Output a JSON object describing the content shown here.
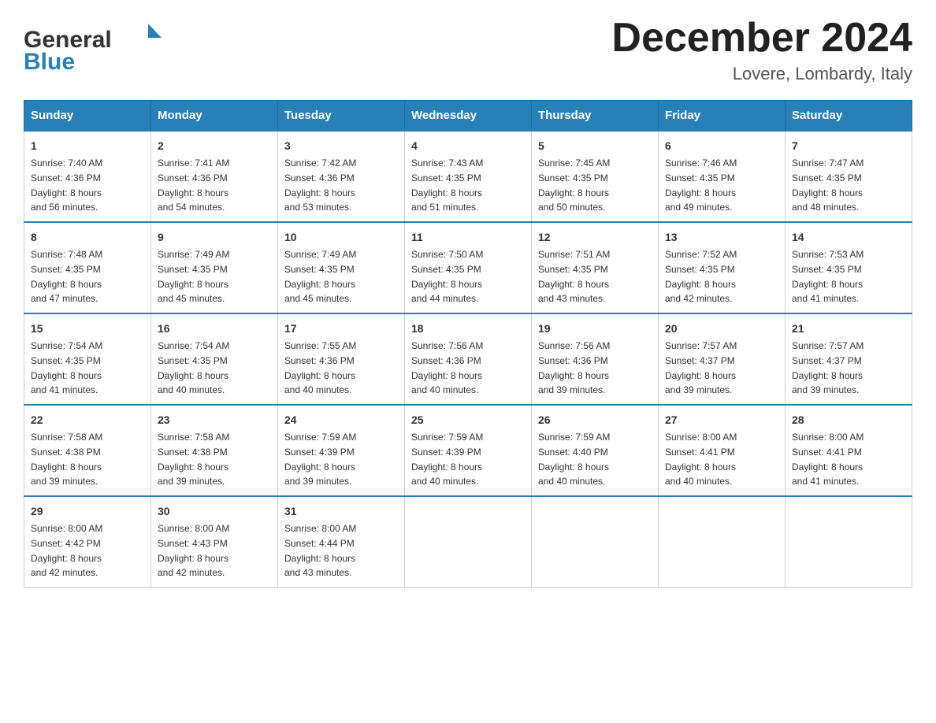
{
  "header": {
    "logo": {
      "general": "General",
      "blue": "Blue"
    },
    "title": "December 2024",
    "location": "Lovere, Lombardy, Italy"
  },
  "weekdays": [
    "Sunday",
    "Monday",
    "Tuesday",
    "Wednesday",
    "Thursday",
    "Friday",
    "Saturday"
  ],
  "weeks": [
    [
      {
        "day": "1",
        "sunrise": "7:40 AM",
        "sunset": "4:36 PM",
        "daylight": "8 hours and 56 minutes."
      },
      {
        "day": "2",
        "sunrise": "7:41 AM",
        "sunset": "4:36 PM",
        "daylight": "8 hours and 54 minutes."
      },
      {
        "day": "3",
        "sunrise": "7:42 AM",
        "sunset": "4:36 PM",
        "daylight": "8 hours and 53 minutes."
      },
      {
        "day": "4",
        "sunrise": "7:43 AM",
        "sunset": "4:35 PM",
        "daylight": "8 hours and 51 minutes."
      },
      {
        "day": "5",
        "sunrise": "7:45 AM",
        "sunset": "4:35 PM",
        "daylight": "8 hours and 50 minutes."
      },
      {
        "day": "6",
        "sunrise": "7:46 AM",
        "sunset": "4:35 PM",
        "daylight": "8 hours and 49 minutes."
      },
      {
        "day": "7",
        "sunrise": "7:47 AM",
        "sunset": "4:35 PM",
        "daylight": "8 hours and 48 minutes."
      }
    ],
    [
      {
        "day": "8",
        "sunrise": "7:48 AM",
        "sunset": "4:35 PM",
        "daylight": "8 hours and 47 minutes."
      },
      {
        "day": "9",
        "sunrise": "7:49 AM",
        "sunset": "4:35 PM",
        "daylight": "8 hours and 45 minutes."
      },
      {
        "day": "10",
        "sunrise": "7:49 AM",
        "sunset": "4:35 PM",
        "daylight": "8 hours and 45 minutes."
      },
      {
        "day": "11",
        "sunrise": "7:50 AM",
        "sunset": "4:35 PM",
        "daylight": "8 hours and 44 minutes."
      },
      {
        "day": "12",
        "sunrise": "7:51 AM",
        "sunset": "4:35 PM",
        "daylight": "8 hours and 43 minutes."
      },
      {
        "day": "13",
        "sunrise": "7:52 AM",
        "sunset": "4:35 PM",
        "daylight": "8 hours and 42 minutes."
      },
      {
        "day": "14",
        "sunrise": "7:53 AM",
        "sunset": "4:35 PM",
        "daylight": "8 hours and 41 minutes."
      }
    ],
    [
      {
        "day": "15",
        "sunrise": "7:54 AM",
        "sunset": "4:35 PM",
        "daylight": "8 hours and 41 minutes."
      },
      {
        "day": "16",
        "sunrise": "7:54 AM",
        "sunset": "4:35 PM",
        "daylight": "8 hours and 40 minutes."
      },
      {
        "day": "17",
        "sunrise": "7:55 AM",
        "sunset": "4:36 PM",
        "daylight": "8 hours and 40 minutes."
      },
      {
        "day": "18",
        "sunrise": "7:56 AM",
        "sunset": "4:36 PM",
        "daylight": "8 hours and 40 minutes."
      },
      {
        "day": "19",
        "sunrise": "7:56 AM",
        "sunset": "4:36 PM",
        "daylight": "8 hours and 39 minutes."
      },
      {
        "day": "20",
        "sunrise": "7:57 AM",
        "sunset": "4:37 PM",
        "daylight": "8 hours and 39 minutes."
      },
      {
        "day": "21",
        "sunrise": "7:57 AM",
        "sunset": "4:37 PM",
        "daylight": "8 hours and 39 minutes."
      }
    ],
    [
      {
        "day": "22",
        "sunrise": "7:58 AM",
        "sunset": "4:38 PM",
        "daylight": "8 hours and 39 minutes."
      },
      {
        "day": "23",
        "sunrise": "7:58 AM",
        "sunset": "4:38 PM",
        "daylight": "8 hours and 39 minutes."
      },
      {
        "day": "24",
        "sunrise": "7:59 AM",
        "sunset": "4:39 PM",
        "daylight": "8 hours and 39 minutes."
      },
      {
        "day": "25",
        "sunrise": "7:59 AM",
        "sunset": "4:39 PM",
        "daylight": "8 hours and 40 minutes."
      },
      {
        "day": "26",
        "sunrise": "7:59 AM",
        "sunset": "4:40 PM",
        "daylight": "8 hours and 40 minutes."
      },
      {
        "day": "27",
        "sunrise": "8:00 AM",
        "sunset": "4:41 PM",
        "daylight": "8 hours and 40 minutes."
      },
      {
        "day": "28",
        "sunrise": "8:00 AM",
        "sunset": "4:41 PM",
        "daylight": "8 hours and 41 minutes."
      }
    ],
    [
      {
        "day": "29",
        "sunrise": "8:00 AM",
        "sunset": "4:42 PM",
        "daylight": "8 hours and 42 minutes."
      },
      {
        "day": "30",
        "sunrise": "8:00 AM",
        "sunset": "4:43 PM",
        "daylight": "8 hours and 42 minutes."
      },
      {
        "day": "31",
        "sunrise": "8:00 AM",
        "sunset": "4:44 PM",
        "daylight": "8 hours and 43 minutes."
      },
      null,
      null,
      null,
      null
    ]
  ],
  "labels": {
    "sunrise": "Sunrise:",
    "sunset": "Sunset:",
    "daylight": "Daylight:"
  }
}
